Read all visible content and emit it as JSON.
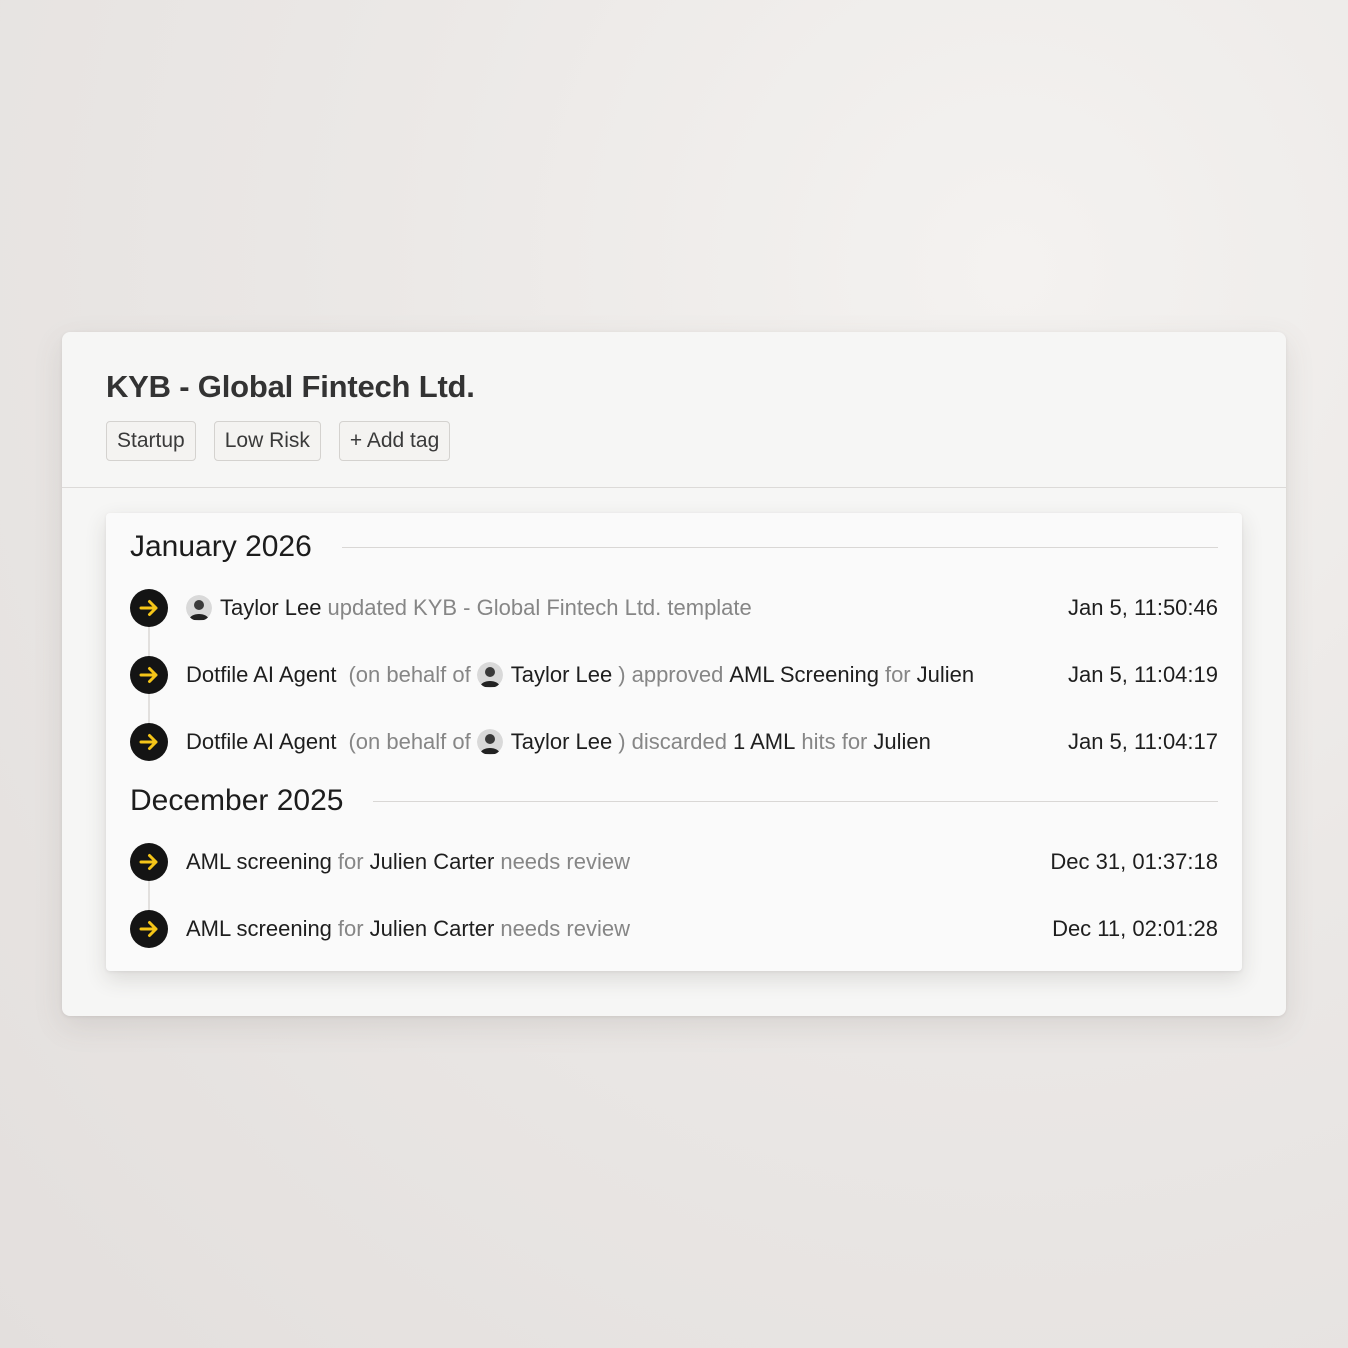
{
  "case": {
    "title": "KYB - Global Fintech Ltd.",
    "tags": [
      "Startup",
      "Low Risk"
    ],
    "add_tag_label": "+ Add tag"
  },
  "timeline": {
    "groups": [
      {
        "month": "January 2026",
        "events": [
          {
            "actor": "Taylor Lee",
            "action": "updated",
            "object": "KYB - Global Fintech Ltd. template",
            "time": "Jan 5, 11:50:46"
          },
          {
            "agent": "Dotfile AI Agent",
            "behalf_prefix": "(on behalf of",
            "on_behalf_of": "Taylor Lee",
            "behalf_suffix": ")",
            "action": "approved",
            "object": "AML Screening",
            "connector": "for",
            "subject": "Julien",
            "time": "Jan 5, 11:04:19"
          },
          {
            "agent": "Dotfile AI Agent",
            "behalf_prefix": "(on behalf of",
            "on_behalf_of": "Taylor Lee",
            "behalf_suffix": ")",
            "action": "discarded",
            "count_label": "1 AML",
            "object": "hits for",
            "subject": "Julien",
            "time": "Jan 5, 11:04:17"
          }
        ]
      },
      {
        "month": "December 2025",
        "events": [
          {
            "object": "AML screening",
            "connector": "for",
            "subject": "Julien Carter",
            "status": "needs review",
            "time": "Dec 31, 01:37:18"
          },
          {
            "object": "AML screening",
            "connector": "for",
            "subject": "Julien Carter",
            "status": "needs review",
            "time": "Dec 11, 02:01:28"
          }
        ]
      }
    ]
  },
  "colors": {
    "event_icon_bg": "#141414",
    "event_icon_arrow": "#f5c518",
    "text_dark": "#1e1e1e",
    "text_muted": "#868686"
  },
  "icons": {
    "event": "arrow-right-icon",
    "user": "avatar"
  }
}
